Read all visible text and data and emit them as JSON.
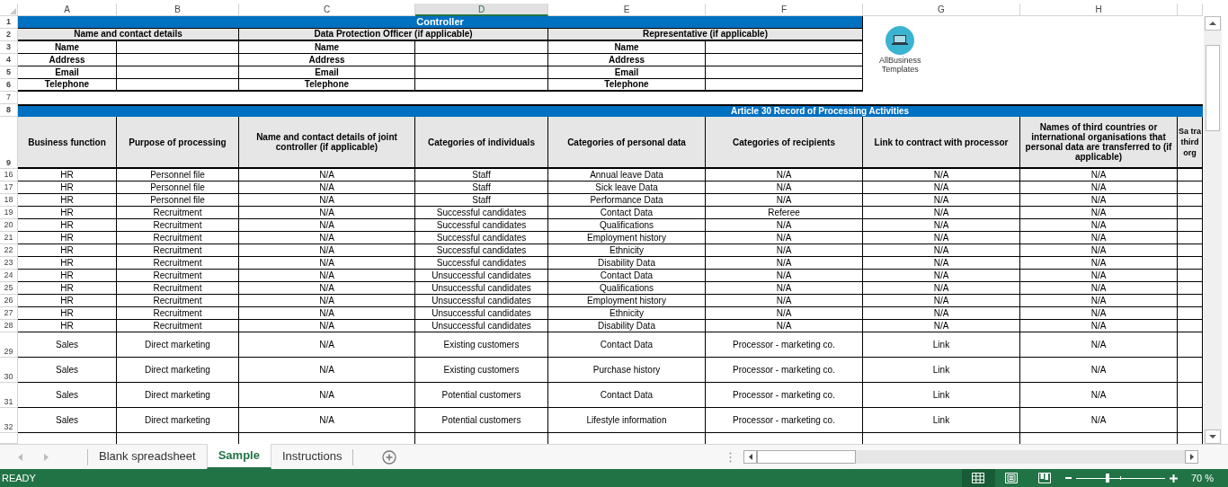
{
  "column_headers": [
    {
      "label": "A",
      "selected": false
    },
    {
      "label": "B",
      "selected": false
    },
    {
      "label": "C",
      "selected": false
    },
    {
      "label": "D",
      "selected": true
    },
    {
      "label": "E",
      "selected": false
    },
    {
      "label": "F",
      "selected": false
    },
    {
      "label": "G",
      "selected": false
    },
    {
      "label": "H",
      "selected": false
    }
  ],
  "controller": {
    "row_numbers": [
      "1",
      "2",
      "3",
      "4",
      "5",
      "6",
      "7"
    ],
    "title": "Controller",
    "sections": [
      {
        "heading": "Name and contact details",
        "fields": [
          "Name",
          "Address",
          "Email",
          "Telephone"
        ]
      },
      {
        "heading": "Data Protection Officer (if applicable)",
        "fields": [
          "Name",
          "Address",
          "Email",
          "Telephone"
        ]
      },
      {
        "heading": "Representative (if applicable)",
        "fields": [
          "Name",
          "Address",
          "Email",
          "Telephone"
        ]
      }
    ]
  },
  "logo": {
    "lines": [
      "AllBusiness",
      "Templates"
    ]
  },
  "record": {
    "title_row_number": "8",
    "title": "Article 30 Record of Processing Activities",
    "header_row_number": "9",
    "columns": [
      "Business function",
      "Purpose of processing",
      "Name and contact details of joint controller (if applicable)",
      "Categories of individuals",
      "Categories of personal data",
      "Categories of recipients",
      "Link to contract with processor",
      "Names of third countries or international organisations that personal data are transferred to (if applicable)",
      "Sa tra third org"
    ],
    "rows": [
      {
        "number": "16",
        "kind": "normal",
        "cells": [
          "HR",
          "Personnel file",
          "N/A",
          "Staff",
          "Annual leave Data",
          "N/A",
          "N/A",
          "N/A"
        ]
      },
      {
        "number": "17",
        "kind": "normal",
        "cells": [
          "HR",
          "Personnel file",
          "N/A",
          "Staff",
          "Sick leave Data",
          "N/A",
          "N/A",
          "N/A"
        ]
      },
      {
        "number": "18",
        "kind": "normal",
        "cells": [
          "HR",
          "Personnel file",
          "N/A",
          "Staff",
          "Performance Data",
          "N/A",
          "N/A",
          "N/A"
        ]
      },
      {
        "number": "19",
        "kind": "normal",
        "cells": [
          "HR",
          "Recruitment",
          "N/A",
          "Successful candidates",
          "Contact Data",
          "Referee",
          "N/A",
          "N/A"
        ]
      },
      {
        "number": "20",
        "kind": "normal",
        "cells": [
          "HR",
          "Recruitment",
          "N/A",
          "Successful candidates",
          "Qualifications",
          "N/A",
          "N/A",
          "N/A"
        ]
      },
      {
        "number": "21",
        "kind": "normal",
        "cells": [
          "HR",
          "Recruitment",
          "N/A",
          "Successful candidates",
          "Employment history",
          "N/A",
          "N/A",
          "N/A"
        ]
      },
      {
        "number": "22",
        "kind": "normal",
        "cells": [
          "HR",
          "Recruitment",
          "N/A",
          "Successful candidates",
          "Ethnicity",
          "N/A",
          "N/A",
          "N/A"
        ]
      },
      {
        "number": "23",
        "kind": "normal",
        "cells": [
          "HR",
          "Recruitment",
          "N/A",
          "Successful candidates",
          "Disability Data",
          "N/A",
          "N/A",
          "N/A"
        ]
      },
      {
        "number": "24",
        "kind": "normal",
        "cells": [
          "HR",
          "Recruitment",
          "N/A",
          "Unsuccessful candidates",
          "Contact Data",
          "N/A",
          "N/A",
          "N/A"
        ]
      },
      {
        "number": "25",
        "kind": "normal",
        "cells": [
          "HR",
          "Recruitment",
          "N/A",
          "Unsuccessful candidates",
          "Qualifications",
          "N/A",
          "N/A",
          "N/A"
        ]
      },
      {
        "number": "26",
        "kind": "normal",
        "cells": [
          "HR",
          "Recruitment",
          "N/A",
          "Unsuccessful candidates",
          "Employment history",
          "N/A",
          "N/A",
          "N/A"
        ]
      },
      {
        "number": "27",
        "kind": "normal",
        "cells": [
          "HR",
          "Recruitment",
          "N/A",
          "Unsuccessful candidates",
          "Ethnicity",
          "N/A",
          "N/A",
          "N/A"
        ]
      },
      {
        "number": "28",
        "kind": "normal",
        "cells": [
          "HR",
          "Recruitment",
          "N/A",
          "Unsuccessful candidates",
          "Disability Data",
          "N/A",
          "N/A",
          "N/A"
        ]
      },
      {
        "number": "29",
        "kind": "tall",
        "cells": [
          "Sales",
          "Direct marketing",
          "N/A",
          "Existing customers",
          "Contact Data",
          "Processor - marketing co.",
          "Link",
          "N/A"
        ]
      },
      {
        "number": "30",
        "kind": "tall",
        "cells": [
          "Sales",
          "Direct marketing",
          "N/A",
          "Existing customers",
          "Purchase history",
          "Processor - marketing co.",
          "Link",
          "N/A"
        ]
      },
      {
        "number": "31",
        "kind": "tall",
        "cells": [
          "Sales",
          "Direct marketing",
          "N/A",
          "Potential customers",
          "Contact Data",
          "Processor - marketing co.",
          "Link",
          "N/A"
        ]
      },
      {
        "number": "32",
        "kind": "tall",
        "cells": [
          "Sales",
          "Direct marketing",
          "N/A",
          "Potential customers",
          "Lifestyle information",
          "Processor - marketing co.",
          "Link",
          "N/A"
        ]
      }
    ]
  },
  "sheet_tabs": [
    {
      "label": "Blank spreadsheet",
      "selected": false
    },
    {
      "label": "Sample",
      "selected": true
    },
    {
      "label": "Instructions",
      "selected": false
    }
  ],
  "status_bar": {
    "status": "READY",
    "views": [
      {
        "kind": "normal",
        "selected": true
      },
      {
        "kind": "page-layout",
        "selected": false
      },
      {
        "kind": "page-break",
        "selected": false
      }
    ],
    "zoom": {
      "level": 0.35,
      "reading": "70 %"
    }
  }
}
